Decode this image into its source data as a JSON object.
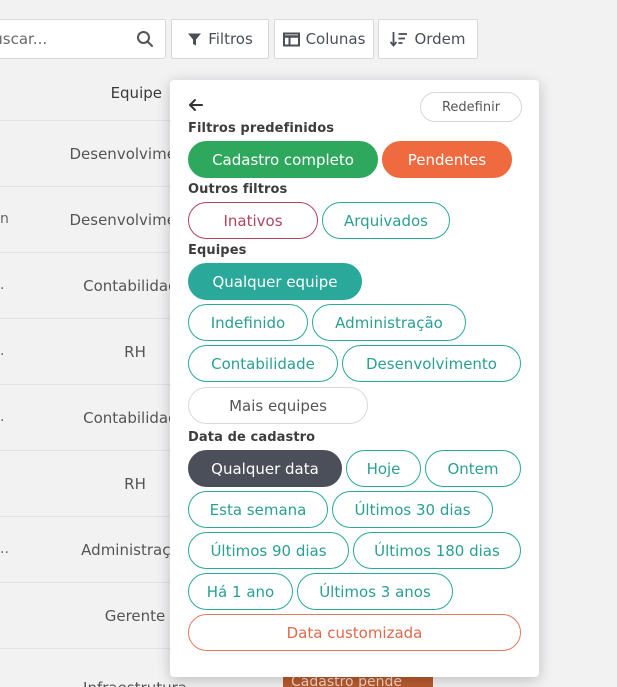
{
  "toolbar": {
    "search_placeholder": "Buscar...",
    "filters_label": "Filtros",
    "columns_label": "Colunas",
    "order_label": "Ordem"
  },
  "table": {
    "header": "Equipe",
    "rows": [
      {
        "left": "",
        "team": "Desenvolvimento"
      },
      {
        "left": "n",
        "team": "Desenvolvimento"
      },
      {
        "left": ".",
        "team": "Contabilidade"
      },
      {
        "left": ".",
        "team": "RH"
      },
      {
        "left": ".",
        "team": "Contabilidade"
      },
      {
        "left": "",
        "team": "RH"
      },
      {
        "left": "..",
        "team": "Administração"
      },
      {
        "left": "",
        "team": "Gerente"
      },
      {
        "left": "",
        "team": "Infraestrutura"
      }
    ],
    "peek_badge": "Cadastro pende"
  },
  "filters": {
    "reset_label": "Redefinir",
    "predefined": {
      "title": "Filtros predefinidos",
      "chips": [
        "Cadastro completo",
        "Pendentes"
      ]
    },
    "others": {
      "title": "Outros filtros",
      "chips": [
        "Inativos",
        "Arquivados"
      ]
    },
    "teams": {
      "title": "Equipes",
      "chips": [
        "Qualquer equipe",
        "Indefinido",
        "Administração",
        "Contabilidade",
        "Desenvolvimento",
        "Mais equipes"
      ]
    },
    "date": {
      "title": "Data de cadastro",
      "chips": [
        "Qualquer data",
        "Hoje",
        "Ontem",
        "Esta semana",
        "Últimos 30 dias",
        "Últimos 90 dias",
        "Últimos 180 dias",
        "Há 1 ano",
        "Últimos 3 anos",
        "Data customizada"
      ]
    }
  },
  "colors": {
    "teal": "#2aa89a",
    "green": "#2ea85d",
    "orange": "#ef6a3f",
    "dark": "#4a4f5a",
    "rose": "#b0435d",
    "coral": "#e57a5d"
  },
  "icons": [
    "search-icon",
    "filter-icon",
    "columns-icon",
    "sort-icon",
    "arrow-left-icon"
  ]
}
